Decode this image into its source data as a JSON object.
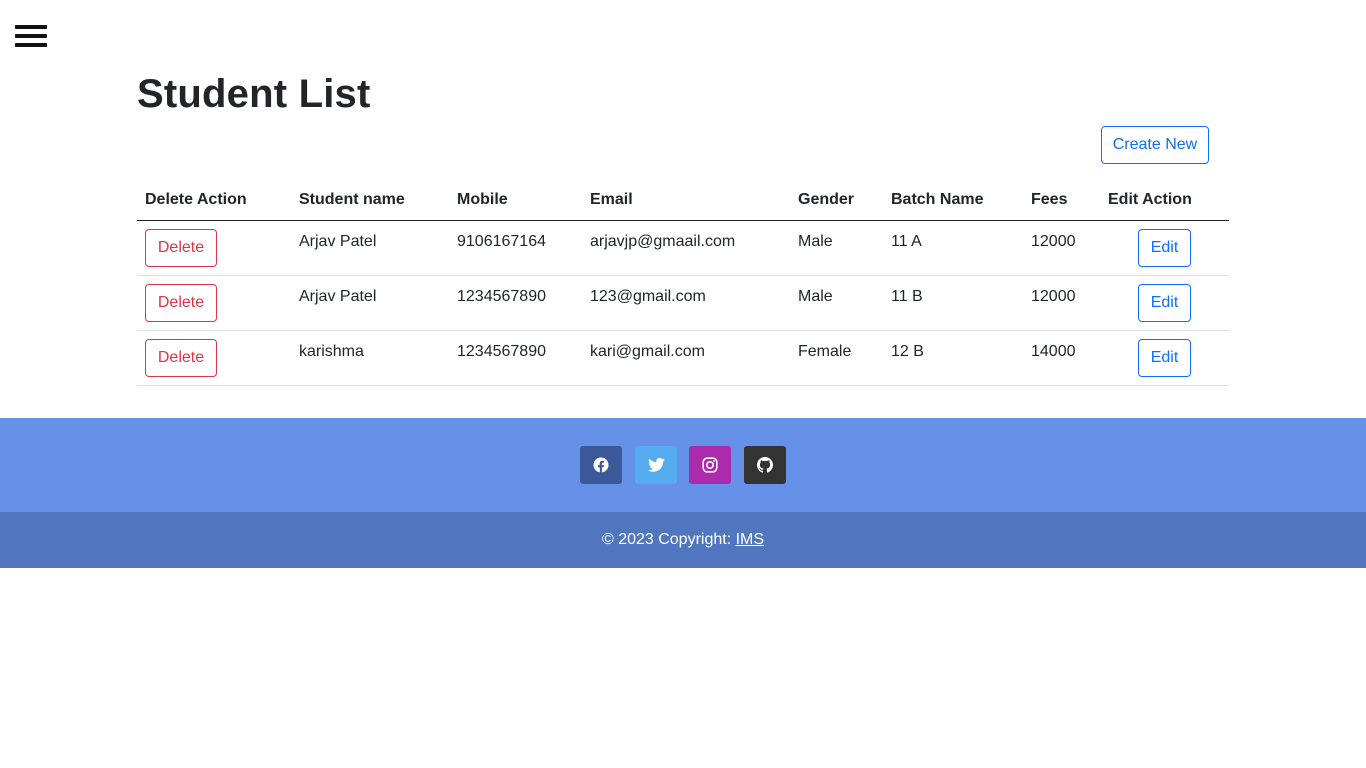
{
  "header": {
    "title": "Student List",
    "create_label": "Create New"
  },
  "table": {
    "columns": [
      "Delete Action",
      "Student name",
      "Mobile",
      "Email",
      "Gender",
      "Batch Name",
      "Fees",
      "Edit Action"
    ],
    "delete_label": "Delete",
    "edit_label": "Edit",
    "rows": [
      {
        "name": "Arjav Patel",
        "mobile": "9106167164",
        "email": "arjavjp@gmaail.com",
        "gender": "Male",
        "batch": "11 A",
        "fees": "12000"
      },
      {
        "name": "Arjav Patel",
        "mobile": "1234567890",
        "email": "123@gmail.com",
        "gender": "Male",
        "batch": "11 B",
        "fees": "12000"
      },
      {
        "name": "karishma",
        "mobile": "1234567890",
        "email": "kari@gmail.com",
        "gender": "Female",
        "batch": "12 B",
        "fees": "14000"
      }
    ]
  },
  "footer": {
    "social": [
      {
        "icon": "facebook-icon",
        "color": "#3b5998"
      },
      {
        "icon": "twitter-icon",
        "color": "#55acee"
      },
      {
        "icon": "instagram-icon",
        "color": "#ac2bac"
      },
      {
        "icon": "github-icon",
        "color": "#333333"
      }
    ],
    "copyright_text": "© 2023 Copyright: ",
    "copyright_link": "IMS"
  },
  "colors": {
    "primary": "#0d6efd",
    "danger": "#dc3545",
    "footer_top": "#6592e8",
    "footer_bottom": "#5076bf"
  }
}
